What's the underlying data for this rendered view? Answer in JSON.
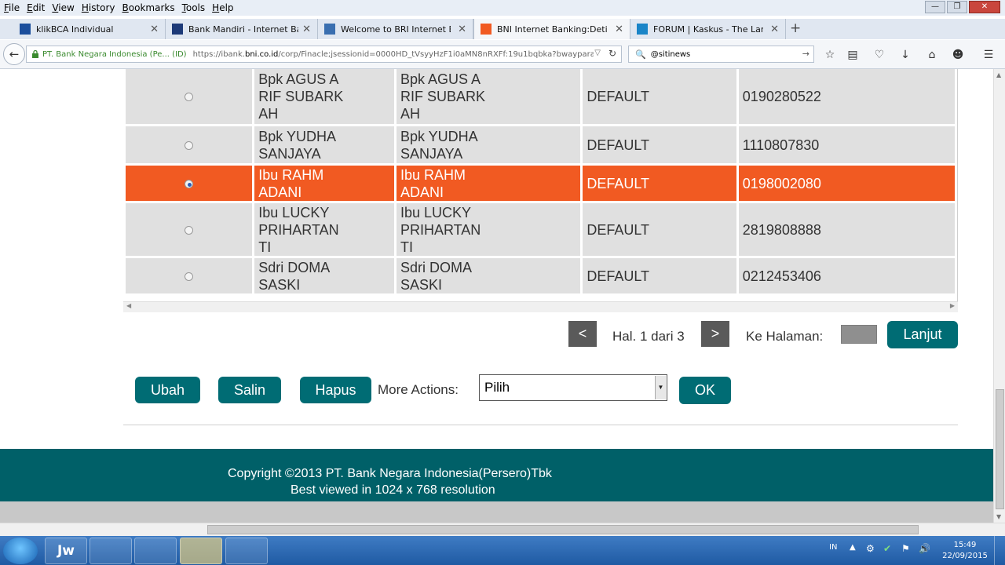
{
  "menubar": {
    "items": [
      {
        "u": "F",
        "rest": "ile"
      },
      {
        "u": "E",
        "rest": "dit"
      },
      {
        "u": "V",
        "rest": "iew"
      },
      {
        "u": "H",
        "rest": "istory"
      },
      {
        "u": "B",
        "rest": "ookmarks"
      },
      {
        "u": "T",
        "rest": "ools"
      },
      {
        "u": "H",
        "rest": "elp"
      }
    ]
  },
  "tabs": [
    {
      "label": "klikBCA Individual",
      "favicon": "bca-icon",
      "color": "#1b4e9c"
    },
    {
      "label": "Bank Mandiri - Internet Ba...",
      "favicon": "mandiri-icon",
      "color": "#1d3a78"
    },
    {
      "label": "Welcome to BRI Internet B...",
      "favicon": "bri-icon",
      "color": "#3a6fb0"
    },
    {
      "label": "BNI Internet Banking:Detil ...",
      "favicon": "bni-icon",
      "color": "#f15a22",
      "active": true
    },
    {
      "label": "FORUM | Kaskus - The Larg...",
      "favicon": "kaskus-icon",
      "color": "#1a85c8"
    }
  ],
  "navbar": {
    "identity": "PT. Bank Negara Indonesia (Pe... (ID)",
    "url_prefix": "https://ibank.",
    "url_domain": "bni.co.id",
    "url_rest": "/corp/Finacle;jsessionid=0000HD_tVsyyHzF1i0aMN8nRXFf:19u1bqbka?bwayparam",
    "search_value": "@sitinews"
  },
  "table": {
    "rows": [
      {
        "name": "Bpk AGUS A RIF SUBARK AH",
        "alias": "Bpk AGUS A RIF SUBARK AH",
        "type": "DEFAULT",
        "account": "0190280522",
        "lines1": [
          "Bpk AGUS A",
          "RIF SUBARK",
          "AH"
        ],
        "selected": false
      },
      {
        "name": "Bpk YUDHA SANJAYA",
        "alias": "Bpk YUDHA SANJAYA",
        "type": "DEFAULT",
        "account": "1110807830",
        "lines1": [
          "Bpk YUDHA",
          "SANJAYA"
        ],
        "selected": false
      },
      {
        "name": "Ibu RAHM ADANI",
        "alias": "Ibu RAHM ADANI",
        "type": "DEFAULT",
        "account": "0198002080",
        "lines1": [
          "Ibu RAHM",
          "ADANI"
        ],
        "selected": true
      },
      {
        "name": "Ibu LUCKY PRIHARTAN TI",
        "alias": "Ibu LUCKY PRIHARTAN TI",
        "type": "DEFAULT",
        "account": "2819808888",
        "lines1": [
          "Ibu LUCKY",
          "PRIHARTAN",
          "TI"
        ],
        "selected": false
      },
      {
        "name": "Sdri DOMA SASKI",
        "alias": "Sdri DOMA SASKI",
        "type": "DEFAULT",
        "account": "0212453406",
        "lines1": [
          "Sdri DOMA",
          "SASKI"
        ],
        "selected": false
      }
    ]
  },
  "pager": {
    "prev_label": "<",
    "page_info": "Hal. 1 dari 3",
    "next_label": ">",
    "goto_label": "Ke Halaman:",
    "goto_value": "",
    "go_button": "Lanjut"
  },
  "actions": {
    "edit": "Ubah",
    "copy": "Salin",
    "delete": "Hapus",
    "more_label": "More Actions:",
    "select_value": "Pilih",
    "ok": "OK"
  },
  "footer": {
    "copyright": "Copyright ©2013 PT. Bank Negara Indonesia(Persero)Tbk",
    "resolution": "Best viewed in 1024 x 768 resolution"
  },
  "taskbar": {
    "lang": "IN",
    "time": "15:49",
    "date": "22/09/2015",
    "apps": [
      {
        "name": "jw-app-icon",
        "label": "Jw"
      },
      {
        "name": "notepad-icon",
        "label": ""
      },
      {
        "name": "firefox-icon",
        "label": ""
      },
      {
        "name": "paint-icon",
        "label": ""
      },
      {
        "name": "ie-icon",
        "label": ""
      }
    ]
  },
  "colors": {
    "selected_row": "#f15a22",
    "teal_button": "#006c74",
    "footer": "#006068"
  }
}
